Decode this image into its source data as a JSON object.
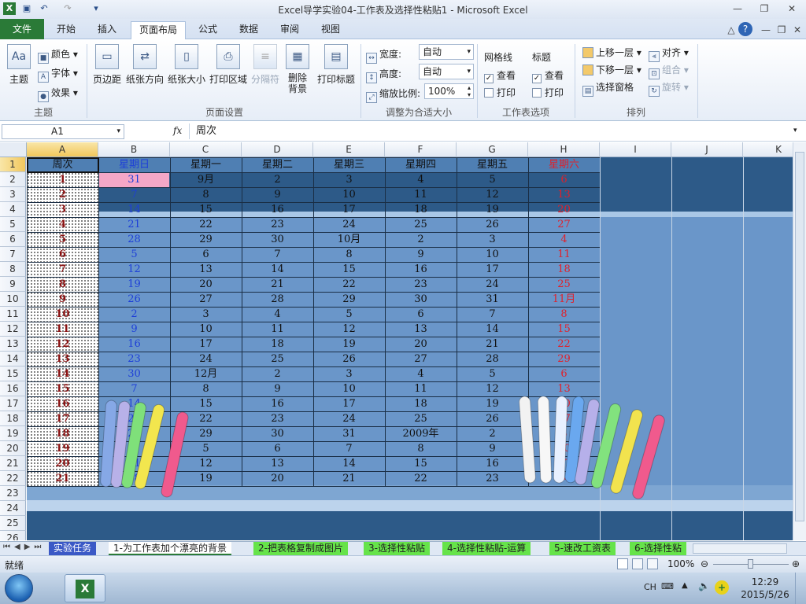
{
  "window": {
    "title": "Excel导学实验04-工作表及选择性粘贴1  -  Microsoft Excel"
  },
  "tabs": [
    "文件",
    "开始",
    "插入",
    "页面布局",
    "公式",
    "数据",
    "审阅",
    "视图"
  ],
  "ribbon": {
    "theme": {
      "label": "主题",
      "colors": "颜色",
      "fonts": "字体",
      "effects": "效果",
      "group": "主题"
    },
    "page_setup": {
      "margins": "页边距",
      "orientation": "纸张方向",
      "size": "纸张大小",
      "print_area": "打印区域",
      "breaks": "分隔符",
      "background": "删除\n背景",
      "print_titles": "打印标题",
      "group": "页面设置"
    },
    "scale": {
      "width_label": "宽度:",
      "width_value": "自动",
      "height_label": "高度:",
      "height_value": "自动",
      "scale_label": "缩放比例:",
      "scale_value": "100%",
      "group": "调整为合适大小"
    },
    "sheet_options": {
      "gridlines": "网格线",
      "headings": "标题",
      "view": "查看",
      "print": "打印",
      "group": "工作表选项"
    },
    "arrange": {
      "bring_forward": "上移一层",
      "send_backward": "下移一层",
      "selection_pane": "选择窗格",
      "align": "对齐",
      "group_btn": "组合",
      "rotate": "旋转",
      "group": "排列"
    }
  },
  "formula_bar": {
    "name_box": "A1",
    "fx": "fx",
    "value": "周次"
  },
  "columns": [
    "A",
    "B",
    "C",
    "D",
    "E",
    "F",
    "G",
    "H",
    "I",
    "J",
    "K"
  ],
  "header_row": [
    "周次",
    "星期日",
    "星期一",
    "星期二",
    "星期三",
    "星期四",
    "星期五",
    "星期六"
  ],
  "rows": [
    [
      "1",
      "31",
      "9月",
      "2",
      "3",
      "4",
      "5",
      "6"
    ],
    [
      "2",
      "7",
      "8",
      "9",
      "10",
      "11",
      "12",
      "13"
    ],
    [
      "3",
      "14",
      "15",
      "16",
      "17",
      "18",
      "19",
      "20"
    ],
    [
      "4",
      "21",
      "22",
      "23",
      "24",
      "25",
      "26",
      "27"
    ],
    [
      "5",
      "28",
      "29",
      "30",
      "10月",
      "2",
      "3",
      "4"
    ],
    [
      "6",
      "5",
      "6",
      "7",
      "8",
      "9",
      "10",
      "11"
    ],
    [
      "7",
      "12",
      "13",
      "14",
      "15",
      "16",
      "17",
      "18"
    ],
    [
      "8",
      "19",
      "20",
      "21",
      "22",
      "23",
      "24",
      "25"
    ],
    [
      "9",
      "26",
      "27",
      "28",
      "29",
      "30",
      "31",
      "11月"
    ],
    [
      "10",
      "2",
      "3",
      "4",
      "5",
      "6",
      "7",
      "8"
    ],
    [
      "11",
      "9",
      "10",
      "11",
      "12",
      "13",
      "14",
      "15"
    ],
    [
      "12",
      "16",
      "17",
      "18",
      "19",
      "20",
      "21",
      "22"
    ],
    [
      "13",
      "23",
      "24",
      "25",
      "26",
      "27",
      "28",
      "29"
    ],
    [
      "14",
      "30",
      "12月",
      "2",
      "3",
      "4",
      "5",
      "6"
    ],
    [
      "15",
      "7",
      "8",
      "9",
      "10",
      "11",
      "12",
      "13"
    ],
    [
      "16",
      "14",
      "15",
      "16",
      "17",
      "18",
      "19",
      "20"
    ],
    [
      "17",
      "21",
      "22",
      "23",
      "24",
      "25",
      "26",
      "27"
    ],
    [
      "18",
      "28",
      "29",
      "30",
      "31",
      "2009年",
      "2",
      "3"
    ],
    [
      "19",
      "4",
      "5",
      "6",
      "7",
      "8",
      "9",
      "10"
    ],
    [
      "20",
      "11",
      "12",
      "13",
      "14",
      "15",
      "16",
      "17"
    ],
    [
      "21",
      "18",
      "19",
      "20",
      "21",
      "22",
      "23",
      "24"
    ]
  ],
  "row_numbers": [
    "1",
    "2",
    "3",
    "4",
    "5",
    "6",
    "7",
    "8",
    "9",
    "10",
    "11",
    "12",
    "13",
    "14",
    "15",
    "16",
    "17",
    "18",
    "19",
    "20",
    "21",
    "22",
    "23",
    "24",
    "25",
    "26"
  ],
  "sheet_tabs": [
    "实验任务",
    "1-为工作表加个漂亮的背景",
    "2-把表格复制成图片",
    "3-选择性粘贴",
    "4-选择性粘贴-运算",
    "5-速改工资表",
    "6-选择性粘"
  ],
  "status": {
    "ready": "就绪",
    "zoom": "100%"
  },
  "taskbar": {
    "lang": "CH",
    "time": "12:29",
    "date": "2015/5/26"
  },
  "colors": {
    "blue_bg": "#6a96c9",
    "dark_bg": "#2d5a88",
    "pink": "#f4a7c7",
    "sunday": "#1d3fd8",
    "saturday": "#e0202a",
    "week": "#8a1010"
  }
}
